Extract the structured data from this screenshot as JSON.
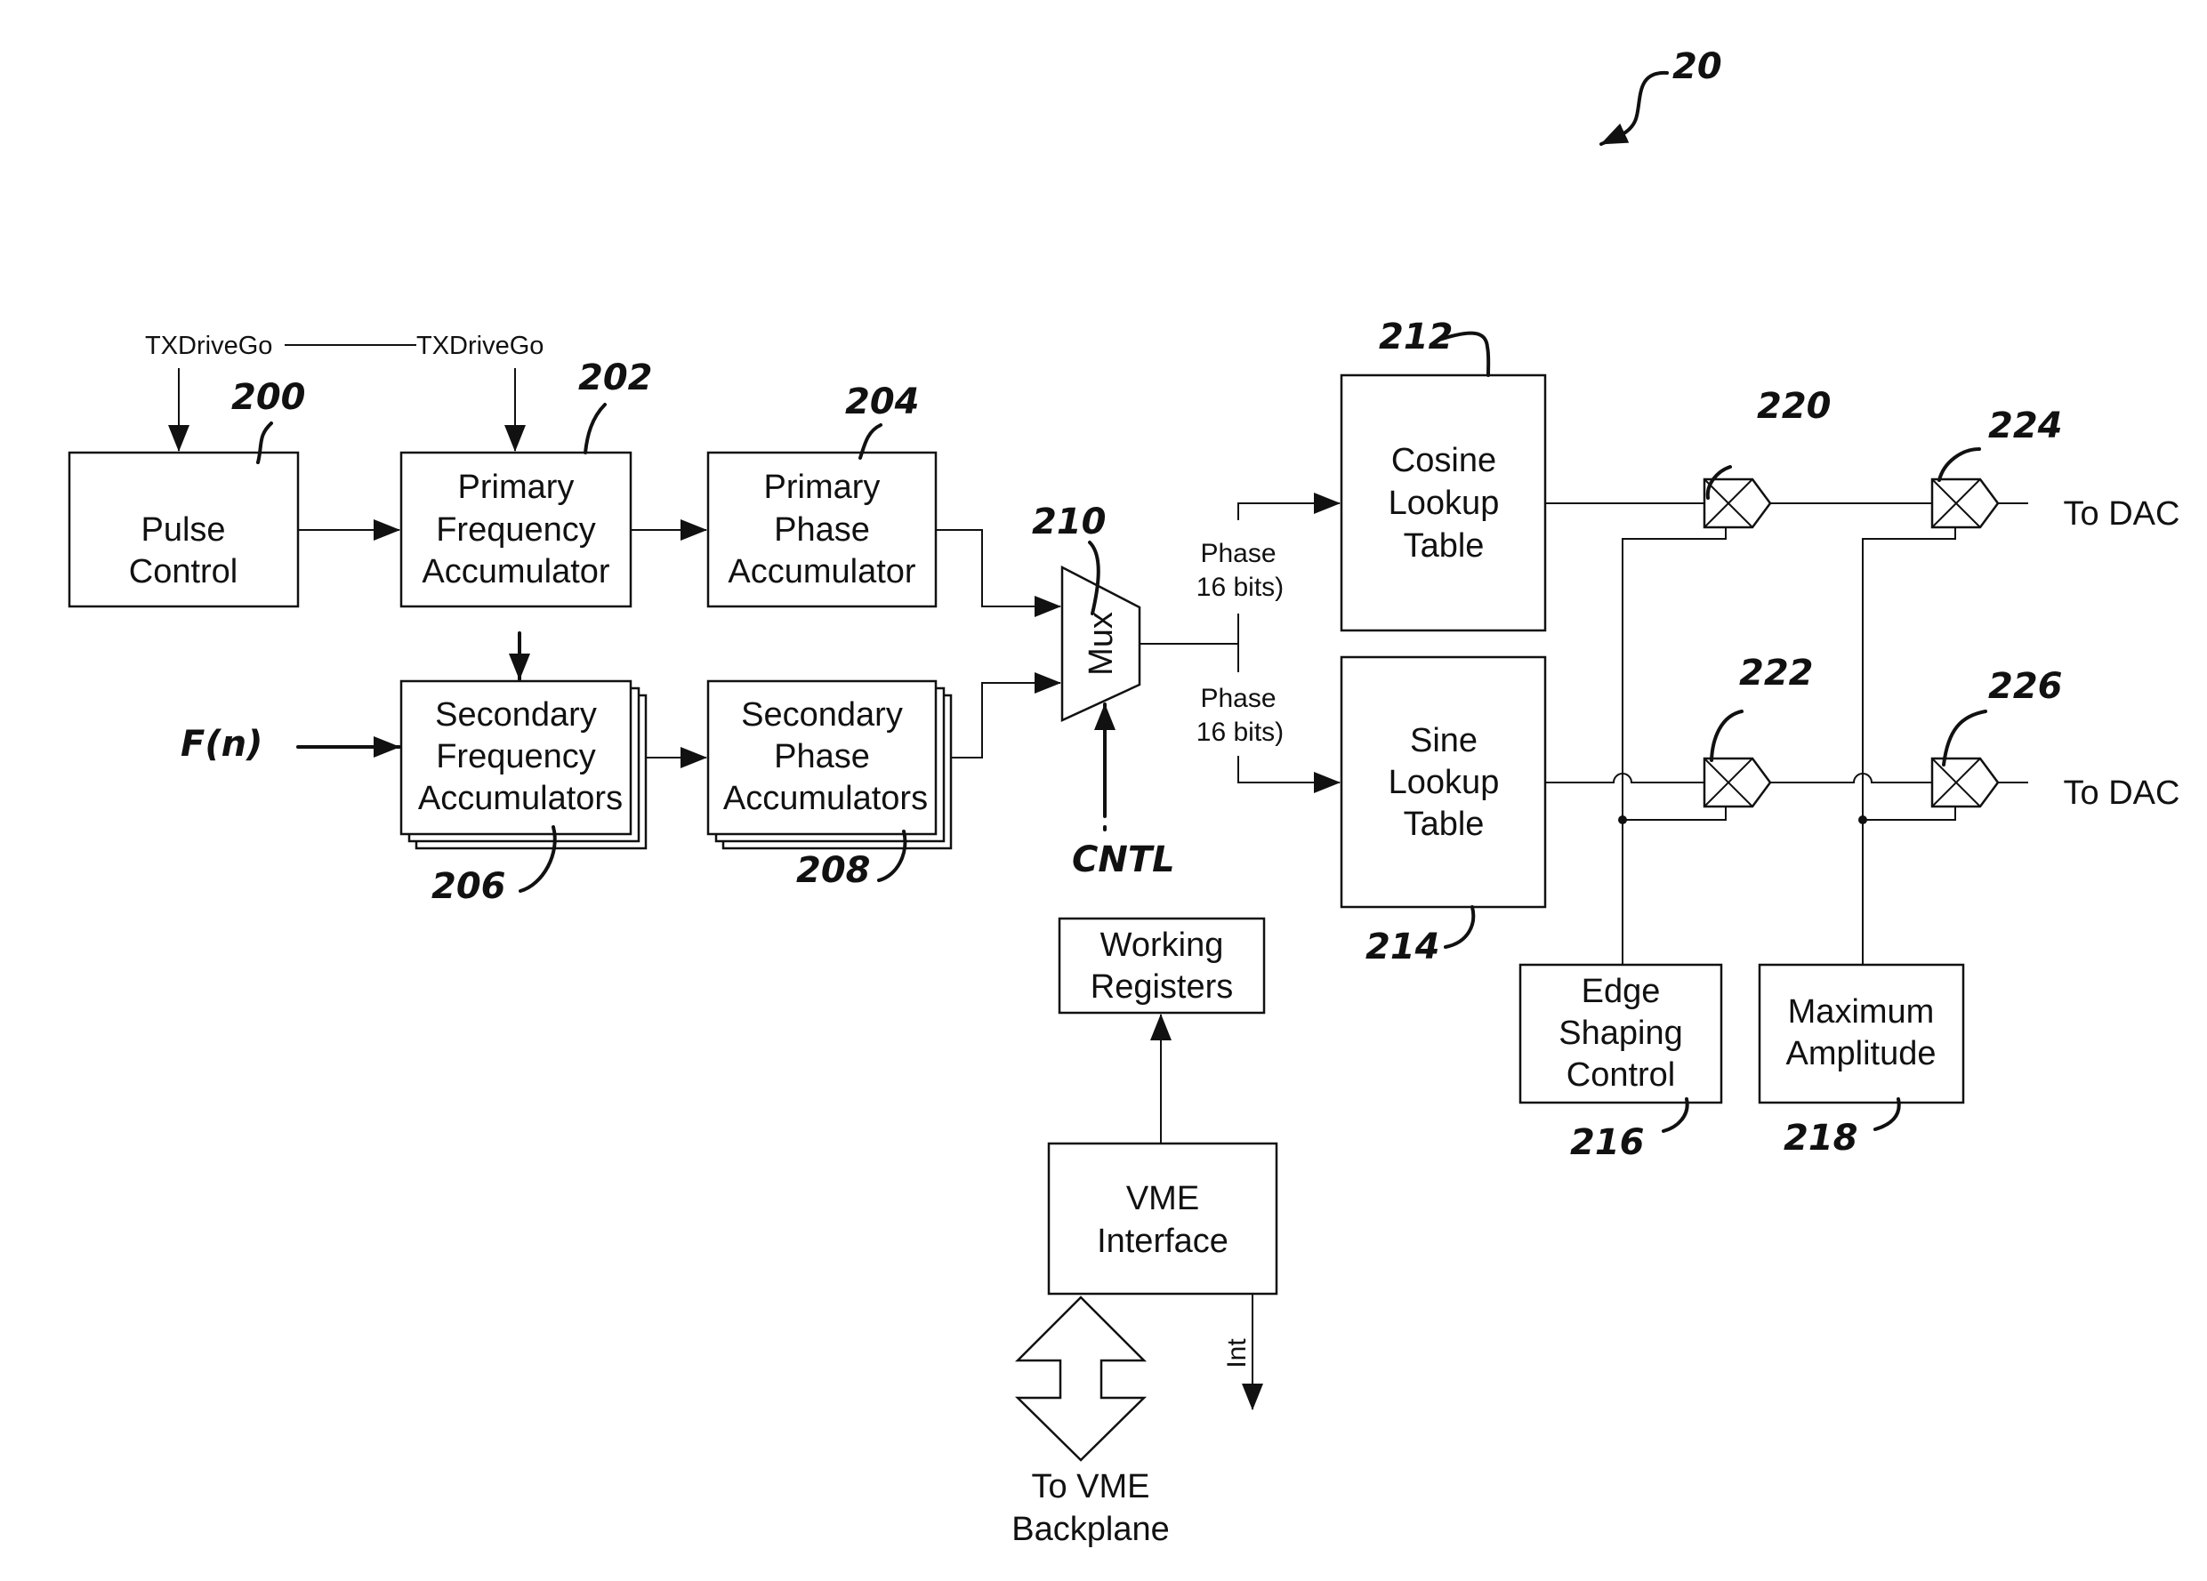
{
  "figure_ref": "20",
  "signals": {
    "txdrivego_1": "TXDriveGo",
    "txdrivego_2": "TXDriveGo",
    "fn_input": "F(n)",
    "cntl": "CNTL",
    "phase_top": "Phase",
    "phase_top_bits": "16 bits)",
    "phase_bottom": "Phase",
    "phase_bottom_bits": "16 bits)",
    "to_dac_top": "To DAC",
    "to_dac_bottom": "To DAC",
    "int": "Int",
    "to_vme_1": "To VME",
    "to_vme_2": "Backplane"
  },
  "blocks": {
    "pulse_control": {
      "lines": [
        "Pulse",
        "Control"
      ],
      "ref": "200"
    },
    "primary_freq": {
      "lines": [
        "Primary",
        "Frequency",
        "Accumulator"
      ],
      "ref": "202"
    },
    "primary_phase": {
      "lines": [
        "Primary",
        "Phase",
        "Accumulator"
      ],
      "ref": "204"
    },
    "secondary_freq": {
      "lines": [
        "Secondary",
        "Frequency",
        "Accumulators"
      ],
      "ref": "206"
    },
    "secondary_phase": {
      "lines": [
        "Secondary",
        "Phase",
        "Accumulators"
      ],
      "ref": "208"
    },
    "mux": {
      "label": "Mux",
      "ref": "210"
    },
    "cosine_lut": {
      "lines": [
        "Cosine",
        "Lookup",
        "Table"
      ],
      "ref": "212"
    },
    "sine_lut": {
      "lines": [
        "Sine",
        "Lookup",
        "Table"
      ],
      "ref": "214"
    },
    "edge_shaping": {
      "lines": [
        "Edge",
        "Shaping",
        "Control"
      ],
      "ref": "216"
    },
    "max_amplitude": {
      "lines": [
        "Maximum",
        "Amplitude"
      ],
      "ref": "218"
    },
    "working_registers": {
      "lines": [
        "Working",
        "Registers"
      ]
    },
    "vme_interface": {
      "lines": [
        "VME",
        "Interface"
      ]
    },
    "mult_220": {
      "ref": "220"
    },
    "mult_222": {
      "ref": "222"
    },
    "mult_224": {
      "ref": "224"
    },
    "mult_226": {
      "ref": "226"
    }
  }
}
